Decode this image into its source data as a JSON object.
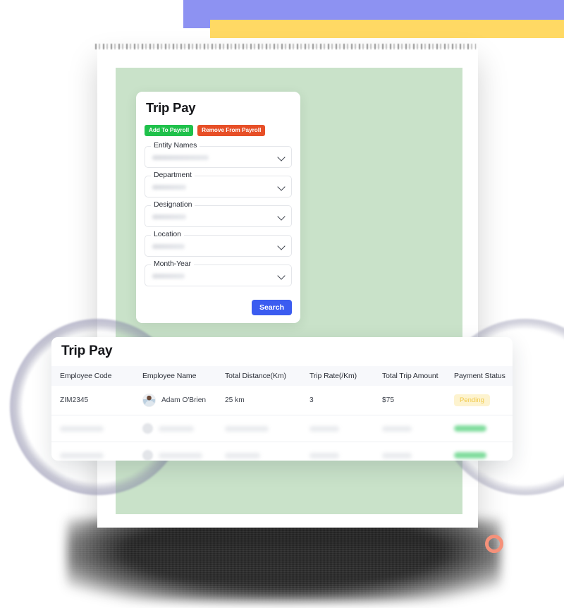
{
  "form_card": {
    "title": "Trip Pay",
    "buttons": {
      "add_label": "Add To Payroll",
      "remove_label": "Remove From Payroll",
      "search_label": "Search"
    },
    "fields": [
      {
        "label": "Entity Names",
        "value": "",
        "skeleton_width": 80
      },
      {
        "label": "Department",
        "value": "",
        "skeleton_width": 48
      },
      {
        "label": "Designation",
        "value": "",
        "skeleton_width": 48
      },
      {
        "label": "Location",
        "value": "",
        "skeleton_width": 46
      },
      {
        "label": "Month-Year",
        "value": "",
        "skeleton_width": 46
      }
    ]
  },
  "table_card": {
    "title": "Trip Pay",
    "columns": [
      "Employee Code",
      "Employee Name",
      "Total Distance(Km)",
      "Trip Rate(/Km)",
      "Total Trip Amount",
      "Payment Status"
    ],
    "rows": [
      {
        "employee_code": "ZIM2345",
        "employee_name": "Adam O'Brien",
        "total_distance": "25 km",
        "trip_rate": "3",
        "total_trip_amount": "$75",
        "payment_status": "Pending"
      }
    ],
    "skeleton_row_count": 2
  },
  "colors": {
    "panel_green": "#c9e2c9",
    "button_add_green": "#1fc14b",
    "button_remove_orange": "#e74f27",
    "search_blue": "#3b5cf0",
    "badge_pending_bg": "#fdf3cf",
    "badge_pending_text": "#f0c94a",
    "deco_periwinkle": "#8d92f2",
    "deco_yellow": "#ffd964",
    "deco_salmon_ring": "#f5917a",
    "table_header_bg": "#f7f8fb"
  }
}
